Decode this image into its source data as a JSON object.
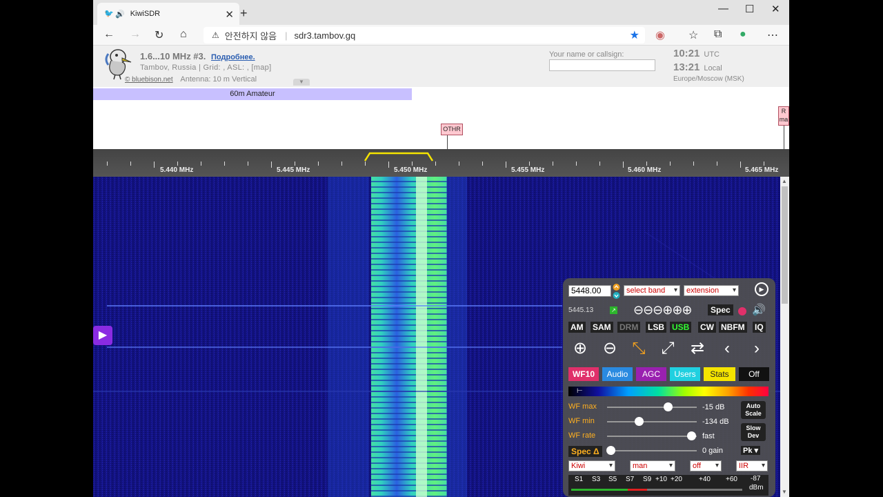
{
  "browser": {
    "tab_title": "KiwiSDR",
    "tab_close": "✕",
    "new_tab": "+",
    "url_warning": "안전하지 않음",
    "url": "sdr3.tambov.gq"
  },
  "header": {
    "title": "1.6...10 MHz #3.",
    "more_link": "Подробнее.",
    "location": "Tambov, Russia | Grid: , ASL: , [map]",
    "copyright": "© bluebison.net",
    "antenna": "Antenna: 10 m Vertical",
    "callsign_label": "Your name or callsign:",
    "utc_time": "10:21",
    "utc_label": "UTC",
    "local_time": "13:21",
    "local_label": "Local",
    "timezone": "Europe/Moscow (MSK)"
  },
  "band": {
    "name": "60m Amateur",
    "label_othr": "OTHR",
    "label_r": "R ma"
  },
  "scale": {
    "freqs": [
      "5.440 MHz",
      "5.445 MHz",
      "5.450 MHz",
      "5.455 MHz",
      "5.460 MHz",
      "5.465 MHz"
    ]
  },
  "control": {
    "frequency": "5448.00",
    "band_select": "select band",
    "extension_select": "extension",
    "sub_freq": "5445.13",
    "spec_label": "Spec",
    "modes": [
      "AM",
      "SAM",
      "DRM",
      "LSB",
      "USB",
      "CW",
      "NBFM",
      "IQ"
    ],
    "tabs": [
      "WF10",
      "Audio",
      "AGC",
      "Users",
      "Stats",
      "Off"
    ],
    "wf_max_label": "WF max",
    "wf_max_value": "-15 dB",
    "wf_min_label": "WF min",
    "wf_min_value": "-134 dB",
    "wf_rate_label": "WF rate",
    "wf_rate_value": "fast",
    "spec_delta": "Spec Δ",
    "gain_value": "0 gain",
    "auto_scale": "Auto Scale",
    "slow_dev": "Slow Dev",
    "pk": "Pk",
    "sel_kiwi": "Kiwi",
    "sel_man": "man",
    "sel_off": "off",
    "sel_iir": "IIR",
    "smeter_labels": [
      "S1",
      "S3",
      "S5",
      "S7",
      "S9",
      "+10",
      "+20",
      "+40",
      "+60"
    ],
    "smeter_value": "-87",
    "smeter_unit": "dBm"
  },
  "colors": {
    "waterfall_bg": "#10107a",
    "band_bar": "#c8c0ff",
    "accent_purple": "#8a2be2"
  }
}
